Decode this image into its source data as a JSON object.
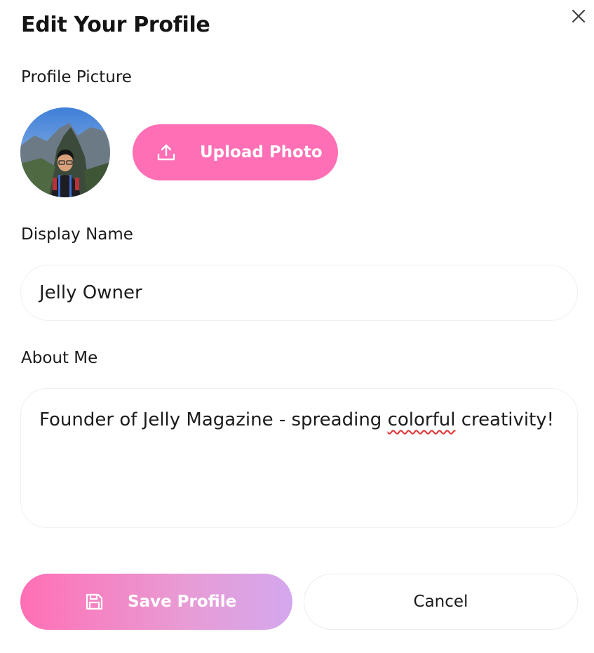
{
  "dialog": {
    "title": "Edit Your Profile",
    "close_icon": "close-icon"
  },
  "profile_picture": {
    "label": "Profile Picture",
    "upload_button_label": "Upload Photo",
    "upload_icon": "upload-icon"
  },
  "display_name": {
    "label": "Display Name",
    "value": "Jelly Owner"
  },
  "about_me": {
    "label": "About Me",
    "value_before_misspelling": "Founder of Jelly Magazine - spreading ",
    "value_misspelled_word": "colorful",
    "value_after_misspelling": " creativity!"
  },
  "actions": {
    "save_label": "Save Profile",
    "save_icon": "save-icon",
    "cancel_label": "Cancel"
  },
  "colors": {
    "accent_pink": "#ff6fb5",
    "gradient_end_lavender": "#d4a8ee",
    "spellcheck_underline": "#e03030"
  }
}
